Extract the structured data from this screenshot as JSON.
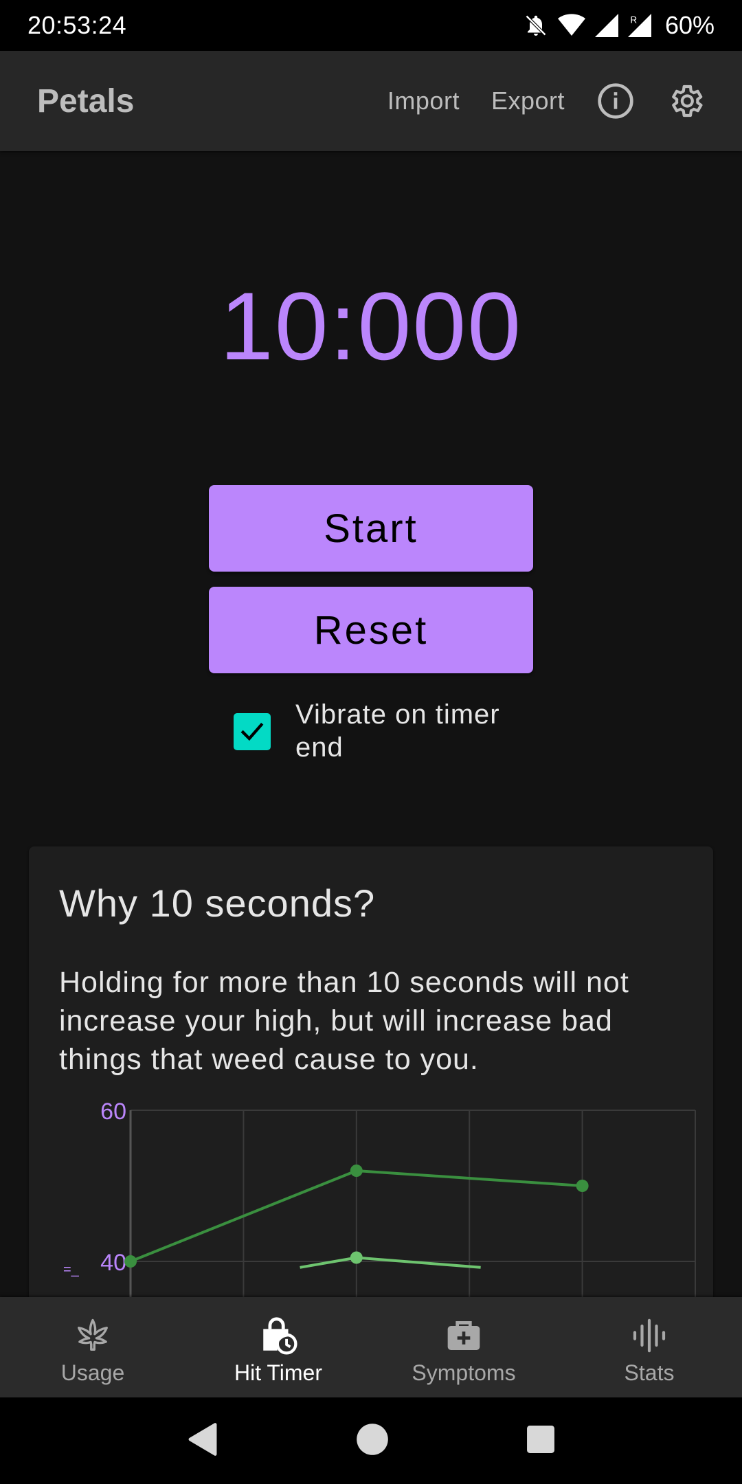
{
  "status_bar": {
    "time": "20:53:24",
    "battery": "60%"
  },
  "app_bar": {
    "title": "Petals",
    "import_label": "Import",
    "export_label": "Export",
    "icons": [
      "info-icon",
      "gear-icon"
    ]
  },
  "timer": {
    "display": "10:000",
    "color": "#bb86fc"
  },
  "controls": {
    "start_label": "Start",
    "reset_label": "Reset",
    "vibrate_label": "Vibrate on timer end",
    "vibrate_checked": true,
    "checkbox_color": "#03dac5"
  },
  "info_card": {
    "title": "Why 10 seconds?",
    "body": "Holding for more than 10 seconds will not increase your high, but will increase bad things that weed cause to you."
  },
  "chart_data": {
    "type": "line",
    "y_ticks": [
      "60",
      "40"
    ],
    "ylim": [
      40,
      60
    ],
    "grid": true,
    "x": [
      0,
      1,
      2,
      3,
      4
    ],
    "series": [
      {
        "color": "#3a8f3f",
        "values": [
          40,
          null,
          52,
          null,
          50
        ]
      },
      {
        "color": "#6ec46f",
        "values": [
          null,
          null,
          40.5,
          null,
          null
        ]
      }
    ]
  },
  "bottom_nav": {
    "items": [
      {
        "label": "Usage",
        "icon": "cannabis-leaf-icon",
        "active": false
      },
      {
        "label": "Hit Timer",
        "icon": "timer-bag-icon",
        "active": true
      },
      {
        "label": "Symptoms",
        "icon": "medical-kit-icon",
        "active": false
      },
      {
        "label": "Stats",
        "icon": "stats-bars-icon",
        "active": false
      }
    ]
  },
  "system_nav": {
    "icons": [
      "back-icon",
      "home-icon",
      "recents-icon"
    ]
  }
}
